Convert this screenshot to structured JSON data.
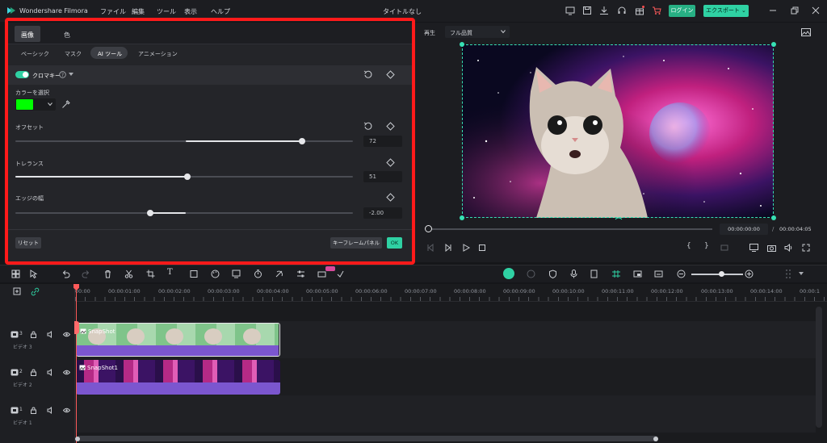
{
  "app": {
    "title": "Wondershare Filmora",
    "project": "タイトルなし"
  },
  "menu": [
    "ファイル",
    "編集",
    "ツール",
    "表示",
    "ヘルプ"
  ],
  "header_buttons": {
    "login": "ログイン",
    "export": "エクスポート ⌄"
  },
  "panel": {
    "tabs": [
      "画像",
      "色"
    ],
    "subtabs": [
      "ベーシック",
      "マスク",
      "AI ツール",
      "アニメーション"
    ],
    "active_subtab": "AI ツール",
    "section": "クロマキー",
    "color_select_label": "カラーを選択",
    "chroma_color": "#00ff00",
    "params": [
      {
        "label": "オフセット",
        "value": "72",
        "fraction": 0.85
      },
      {
        "label": "トレランス",
        "value": "51",
        "fraction": 0.51
      },
      {
        "label": "エッジの幅",
        "value": "-2.00",
        "fraction": 0.4
      }
    ],
    "reset": "リセット",
    "keyframe_panel": "キーフレームパネル",
    "ok": "OK"
  },
  "preview": {
    "play_label": "再生",
    "quality": "フル品質",
    "current_time": "00:00:00:00",
    "separator": "/",
    "total_time": "00:00:04:05"
  },
  "timeline": {
    "ruler": [
      "00:00",
      "00:00:01:00",
      "00:00:02:00",
      "00:00:03:00",
      "00:00:04:00",
      "00:00:05:00",
      "00:00:06:00",
      "00:00:07:00",
      "00:00:08:00",
      "00:00:09:00",
      "00:00:10:00",
      "00:00:11:00",
      "00:00:12:00",
      "00:00:13:00",
      "00:00:14:00",
      "00:00:1"
    ],
    "tracks": [
      {
        "num": "3",
        "name": "ビデオ 3",
        "clip": "SnapShot"
      },
      {
        "num": "2",
        "name": "ビデオ 2",
        "clip": "SnapShot1"
      },
      {
        "num": "1",
        "name": "ビデオ 1",
        "clip": ""
      }
    ]
  },
  "colors": {
    "accent": "#2fd1a3",
    "highlight_box": "#ff1a1a",
    "clip_purple": "#7b56cf"
  }
}
